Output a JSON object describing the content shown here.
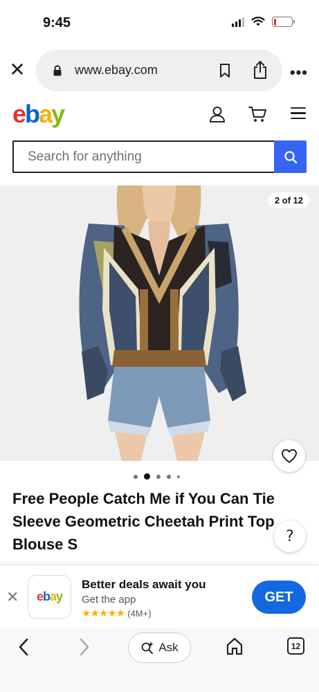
{
  "status_bar": {
    "time": "9:45",
    "battery_level": 0.15,
    "battery_color": "#e0303a",
    "icons": [
      "signal-icon",
      "wifi-icon",
      "battery-icon"
    ]
  },
  "browser": {
    "url": "www.ebay.com",
    "icons": [
      "close-icon",
      "lock-icon",
      "bookmark-icon",
      "share-icon",
      "more-icon"
    ]
  },
  "header": {
    "logo": {
      "e": "e",
      "b": "b",
      "a": "a",
      "y": "y"
    },
    "logo_colors": [
      "#e53238",
      "#0064d2",
      "#f5af02",
      "#86b817"
    ],
    "icons": [
      "user-icon",
      "cart-icon",
      "menu-icon"
    ]
  },
  "search": {
    "placeholder": "Search for anything",
    "value": "",
    "button_color": "#3665f3"
  },
  "product": {
    "image_counter": "2 of 12",
    "current_image": 2,
    "total_images": 12,
    "title": "Free People Catch Me if You Can Tie Sleeve Geometric Cheetah Print Top Blouse S",
    "help_label": "?"
  },
  "app_banner": {
    "app_icon_label": {
      "e": "e",
      "b": "b",
      "a": "a",
      "y": "y"
    },
    "title": "Better deals await you",
    "subtitle": "Get the app",
    "stars": "★★★★★",
    "rating_count": "(4M+)",
    "cta_label": "GET",
    "cta_color": "#1569e0"
  },
  "toolbar": {
    "ask_label": "Ask",
    "tabs_count": "12",
    "icons": [
      "back-icon",
      "forward-icon",
      "ask-sparkle-icon",
      "home-icon",
      "tabs-icon"
    ]
  }
}
